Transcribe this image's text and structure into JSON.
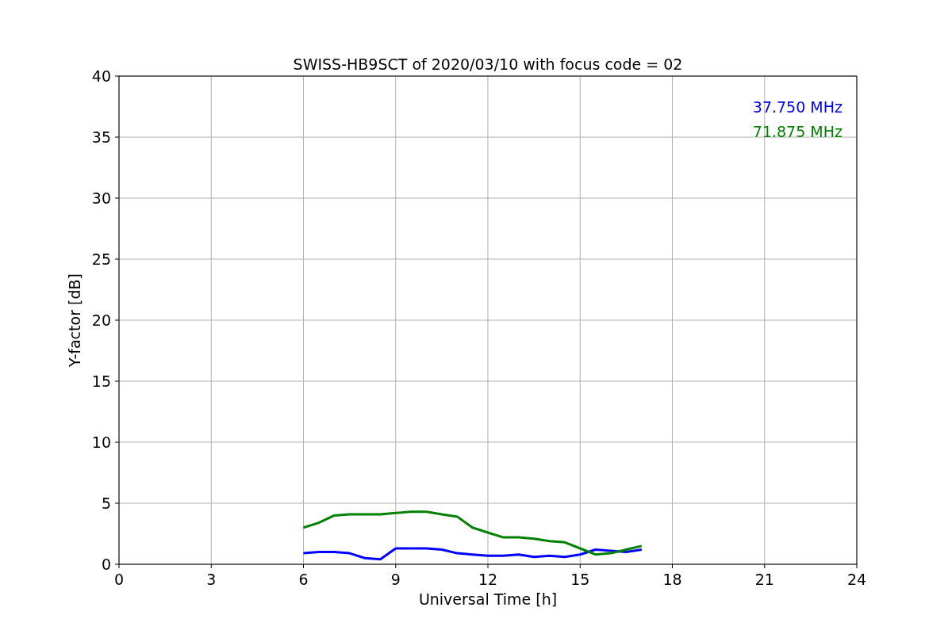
{
  "figure": {
    "chart_data": {
      "type": "line",
      "title": "SWISS-HB9SCT of 2020/03/10 with focus code = 02",
      "xlabel": "Universal Time [h]",
      "ylabel": "Y-factor [dB]",
      "x": [
        6,
        6.5,
        7,
        7.5,
        8,
        8.5,
        9,
        9.5,
        10,
        10.5,
        11,
        11.5,
        12,
        12.5,
        13,
        13.5,
        14,
        14.5,
        15,
        15.5,
        16,
        16.5,
        17
      ],
      "series": [
        {
          "name": "37.750 MHz",
          "color": "#0000ff",
          "values": [
            0.9,
            1.0,
            1.0,
            0.9,
            0.5,
            0.4,
            1.3,
            1.3,
            1.3,
            1.2,
            0.9,
            0.8,
            0.7,
            0.7,
            0.8,
            0.6,
            0.7,
            0.6,
            0.8,
            1.2,
            1.1,
            1.0,
            1.2
          ]
        },
        {
          "name": "71.875 MHz",
          "color": "#008000",
          "values": [
            3.0,
            3.4,
            4.0,
            4.1,
            4.1,
            4.1,
            4.2,
            4.3,
            4.3,
            4.1,
            3.9,
            3.0,
            2.6,
            2.2,
            2.2,
            2.1,
            1.9,
            1.8,
            1.3,
            0.8,
            0.9,
            1.2,
            1.5
          ]
        }
      ],
      "xlim": [
        0,
        24
      ],
      "ylim": [
        0,
        40
      ],
      "xticks": [
        0,
        3,
        6,
        9,
        12,
        15,
        18,
        21,
        24
      ],
      "yticks": [
        0,
        5,
        10,
        15,
        20,
        25,
        30,
        35,
        40
      ],
      "grid": true
    }
  }
}
